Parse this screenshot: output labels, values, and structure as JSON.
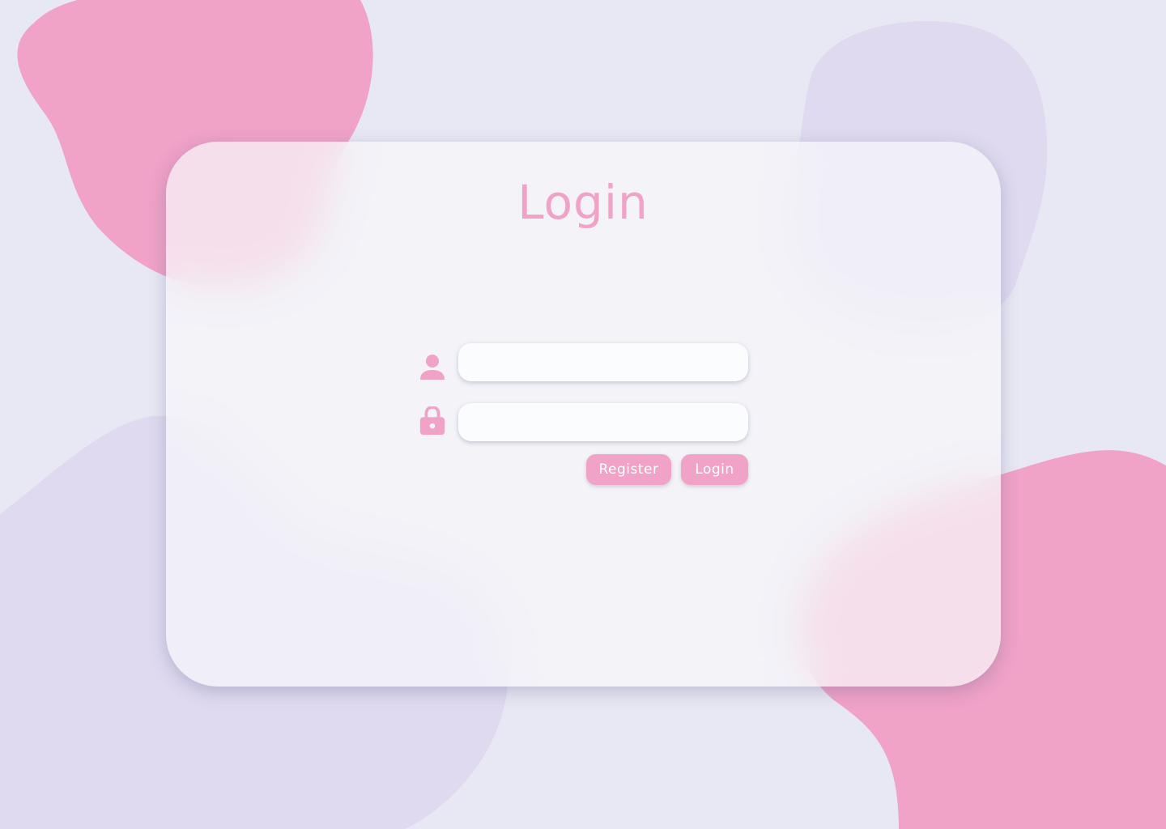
{
  "login": {
    "title": "Login",
    "username": {
      "value": "",
      "placeholder": ""
    },
    "password": {
      "value": "",
      "placeholder": ""
    },
    "register_label": "Register",
    "login_label": "Login"
  },
  "colors": {
    "background": "#e8e8f4",
    "accent_pink": "#f0a2c7",
    "lavender": "#ddd9ef"
  },
  "icons": {
    "username": "user-icon",
    "password": "lock-icon"
  }
}
